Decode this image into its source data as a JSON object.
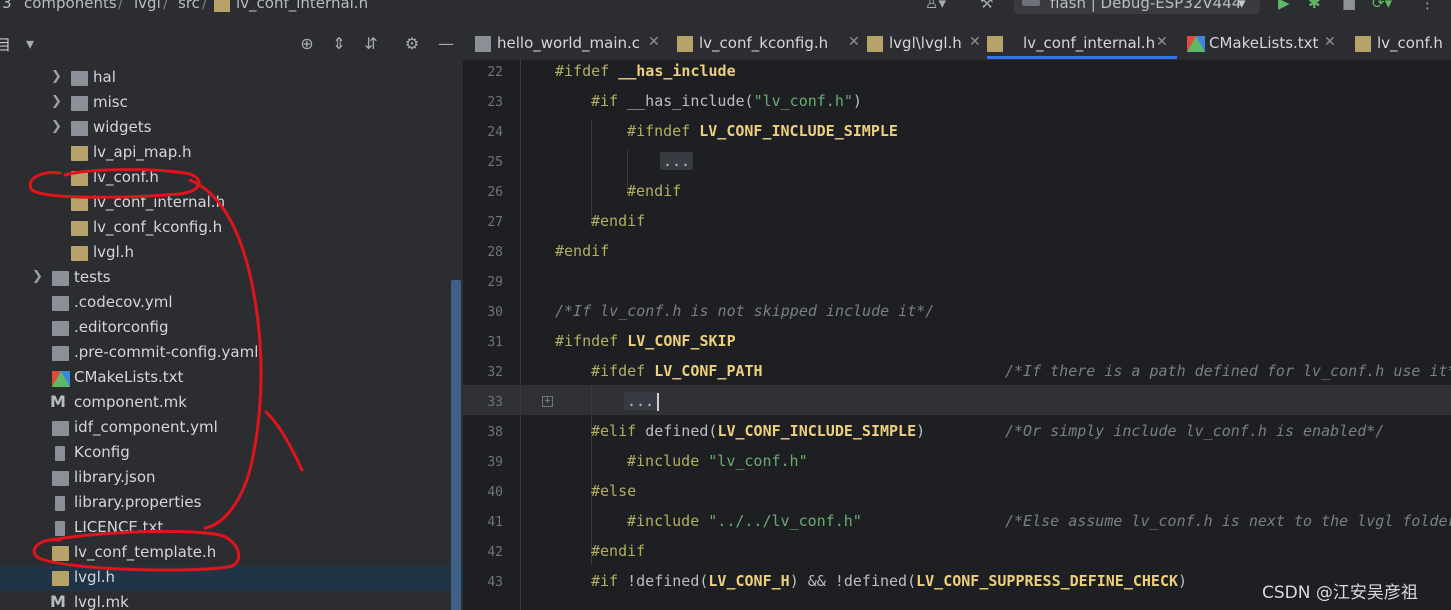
{
  "breadcrumb": {
    "first": "3",
    "items": [
      "components",
      "lvgl",
      "src",
      "lv_conf_internal.h"
    ]
  },
  "toolbar": {
    "run_config": "flash | Debug-ESP32V444"
  },
  "project_panel": {
    "title": "目"
  },
  "tabs": [
    {
      "label": "hello_world_main.c",
      "active": false,
      "icon": "c-file-icon"
    },
    {
      "label": "lv_conf_kconfig.h",
      "active": false,
      "icon": "h-file-icon"
    },
    {
      "label": "lvgl\\lvgl.h",
      "active": false,
      "icon": "h-file-icon"
    },
    {
      "label": "lv_conf_internal.h",
      "active": true,
      "icon": "h-file-icon"
    },
    {
      "label": "CMakeLists.txt",
      "active": false,
      "icon": "cmake-icon"
    },
    {
      "label": "lv_conf.h",
      "active": false,
      "icon": "h-file-icon"
    }
  ],
  "tree": [
    {
      "label": "hal",
      "type": "folder"
    },
    {
      "label": "misc",
      "type": "folder"
    },
    {
      "label": "widgets",
      "type": "folder"
    },
    {
      "label": "lv_api_map.h",
      "type": "h"
    },
    {
      "label": "lv_conf.h",
      "type": "h"
    },
    {
      "label": "lv_conf_internal.h",
      "type": "h"
    },
    {
      "label": "lv_conf_kconfig.h",
      "type": "h"
    },
    {
      "label": "lvgl.h",
      "type": "h"
    },
    {
      "label": "tests",
      "type": "folder"
    },
    {
      "label": ".codecov.yml",
      "type": "yml"
    },
    {
      "label": ".editorconfig",
      "type": "txt"
    },
    {
      "label": ".pre-commit-config.yaml",
      "type": "yml"
    },
    {
      "label": "CMakeLists.txt",
      "type": "cmake"
    },
    {
      "label": "component.mk",
      "type": "mk"
    },
    {
      "label": "idf_component.yml",
      "type": "yml"
    },
    {
      "label": "Kconfig",
      "type": "txt"
    },
    {
      "label": "library.json",
      "type": "json"
    },
    {
      "label": "library.properties",
      "type": "txt"
    },
    {
      "label": "LICENCE.txt",
      "type": "txt"
    },
    {
      "label": "lv_conf_template.h",
      "type": "h"
    },
    {
      "label": "lvgl.h",
      "type": "h",
      "selected": true
    },
    {
      "label": "lvgl.mk",
      "type": "mk"
    }
  ],
  "code": {
    "line_numbers": [
      "22",
      "23",
      "24",
      "25",
      "26",
      "27",
      "28",
      "29",
      "30",
      "31",
      "32",
      "33",
      "38",
      "39",
      "40",
      "41",
      "42",
      "43"
    ],
    "l22": {
      "kw": "#ifdef",
      "mac": "__has_include"
    },
    "l23": {
      "kw": "#if",
      "plain": "__has_include(",
      "str": "\"lv_conf.h\"",
      "close": ")"
    },
    "l24": {
      "kw": "#ifndef",
      "mac": "LV_CONF_INCLUDE_SIMPLE"
    },
    "l25": {
      "fold": "..."
    },
    "l26": {
      "kw": "#endif"
    },
    "l27": {
      "kw": "#endif"
    },
    "l28": {
      "kw": "#endif"
    },
    "l30": {
      "cmt": "/*If lv_conf.h is not skipped include it*/"
    },
    "l31": {
      "kw": "#ifndef",
      "mac": "LV_CONF_SKIP"
    },
    "l32": {
      "kw": "#ifdef",
      "mac": "LV_CONF_PATH",
      "cmt": "/*If there is a path defined for lv_conf.h use it*/"
    },
    "l33": {
      "fold": "..."
    },
    "l38": {
      "kw": "#elif",
      "plain": "defined(",
      "mac": "LV_CONF_INCLUDE_SIMPLE",
      "close": ")",
      "cmt": "/*Or simply include lv_conf.h is enabled*/"
    },
    "l39": {
      "kw": "#include",
      "str": "\"lv_conf.h\""
    },
    "l40": {
      "kw": "#else"
    },
    "l41": {
      "kw": "#include",
      "str": "\"../../lv_conf.h\"",
      "cmt": "/*Else assume lv_conf.h is next to the lvgl folder*/"
    },
    "l42": {
      "kw": "#endif"
    },
    "l43": {
      "kw": "#if",
      "p1": "!defined(",
      "m1": "LV_CONF_H",
      "p2": ") && !defined(",
      "m2": "LV_CONF_SUPPRESS_DEFINE_CHECK",
      "p3": ")"
    }
  },
  "watermark": "CSDN @江安吴彦祖",
  "colors": {
    "accent": "#3574f0",
    "annotation": "#e0141b",
    "selection": "#1f3446"
  }
}
